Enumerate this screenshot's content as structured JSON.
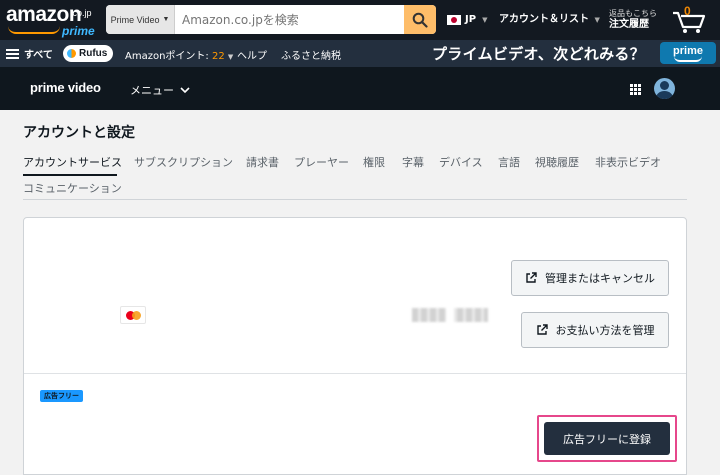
{
  "topnav": {
    "logo_text": "amazon",
    "logo_tld": ".co.jp",
    "logo_prime": "prime",
    "search_category": "Prime Video",
    "search_placeholder": "Amazon.co.jpを検索",
    "language": "JP",
    "account_label": "アカウント＆リスト",
    "orders_line1": "返品もこちら",
    "orders_line2": "注文履歴",
    "cart_count": "0",
    "colors": {
      "bg": "#131921",
      "search_button": "#febd69",
      "accent": "#ff9900"
    }
  },
  "subnav": {
    "all_label": "すべて",
    "rufus_label": "Rufus",
    "points_label": "Amazonポイント:",
    "points_value": "22",
    "help_label": "ヘルプ",
    "furusato_label": "ふるさと納税",
    "banner_text": "プライムビデオ、次どれみる？",
    "prime_badge": "prime"
  },
  "pvbar": {
    "logo": "prime video",
    "menu_label": "メニュー"
  },
  "main": {
    "page_title": "アカウントと設定",
    "tabs": [
      {
        "label": "アカウントサービス",
        "active": true
      },
      {
        "label": "サブスクリプション"
      },
      {
        "label": "請求書"
      },
      {
        "label": "プレーヤー"
      },
      {
        "label": "権限"
      },
      {
        "label": "字幕"
      },
      {
        "label": "デバイス"
      },
      {
        "label": "言語"
      },
      {
        "label": "視聴履歴"
      },
      {
        "label": "非表示ビデオ"
      },
      {
        "label": "コミュニケーション"
      }
    ],
    "manage_cancel_button": "管理またはキャンセル",
    "manage_payment_button": "お支払い方法を管理",
    "adfree_badge": "広告フリー",
    "adfree_register_button": "広告フリーに登録",
    "highlight_color": "#e6478b"
  }
}
